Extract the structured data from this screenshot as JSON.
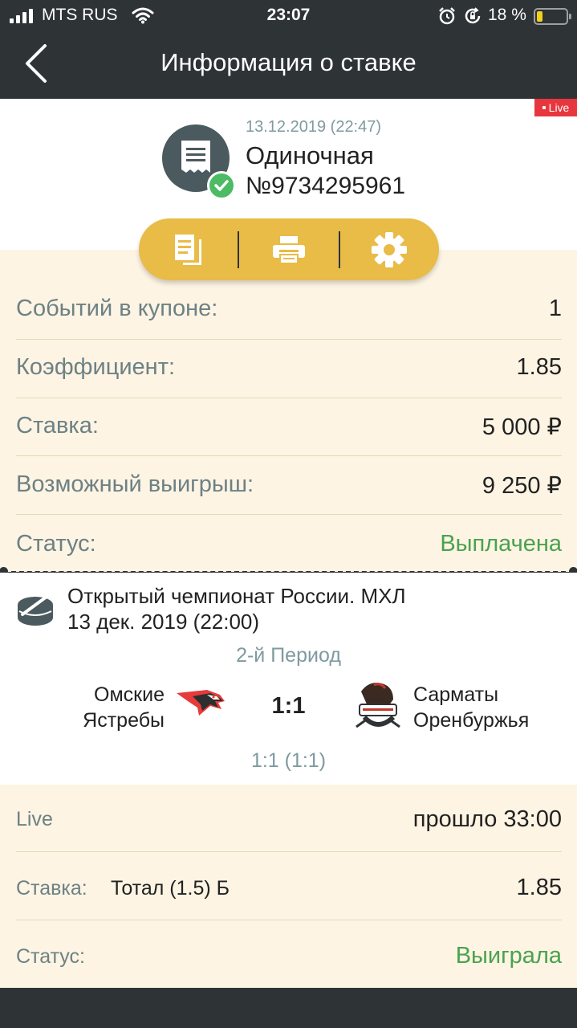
{
  "status_bar": {
    "carrier": "MTS RUS",
    "time": "23:07",
    "battery": "18 %",
    "battery_level": 0.18
  },
  "nav": {
    "title": "Информация о ставке"
  },
  "header": {
    "live_badge": "Live",
    "date": "13.12.2019 (22:47)",
    "bet_type": "Одиночная",
    "bet_number": "№9734295961"
  },
  "summary": {
    "rows": [
      {
        "label": "Событий в купоне:",
        "value": "1"
      },
      {
        "label": "Коэффициент:",
        "value": "1.85"
      },
      {
        "label": "Ставка:",
        "value": "5 000 ₽"
      },
      {
        "label": "Возможный выигрыш:",
        "value": "9 250 ₽"
      },
      {
        "label": "Статус:",
        "value": "Выплачена"
      }
    ]
  },
  "event": {
    "tournament": "Открытый чемпионат России. МХЛ",
    "date": "13 дек. 2019 (22:00)",
    "period": "2-й Период",
    "team1_line1": "Омские",
    "team1_line2": "Ястребы",
    "score": "1:1",
    "team2_line1": "Сарматы",
    "team2_line2": "Оренбуржья",
    "subscore": "1:1 (1:1)"
  },
  "bet": {
    "live_label": "Live",
    "elapsed": "прошло 33:00",
    "stake_label": "Ставка:",
    "outcome": "Тотал (1.5) Б",
    "odds": "1.85",
    "status_label": "Статус:",
    "status": "Выиграла"
  },
  "colors": {
    "dark": "#2e3336",
    "accent": "#e9bb47",
    "cream": "#fdf4e3",
    "green": "#4aa24f",
    "live_red": "#e8363f"
  }
}
